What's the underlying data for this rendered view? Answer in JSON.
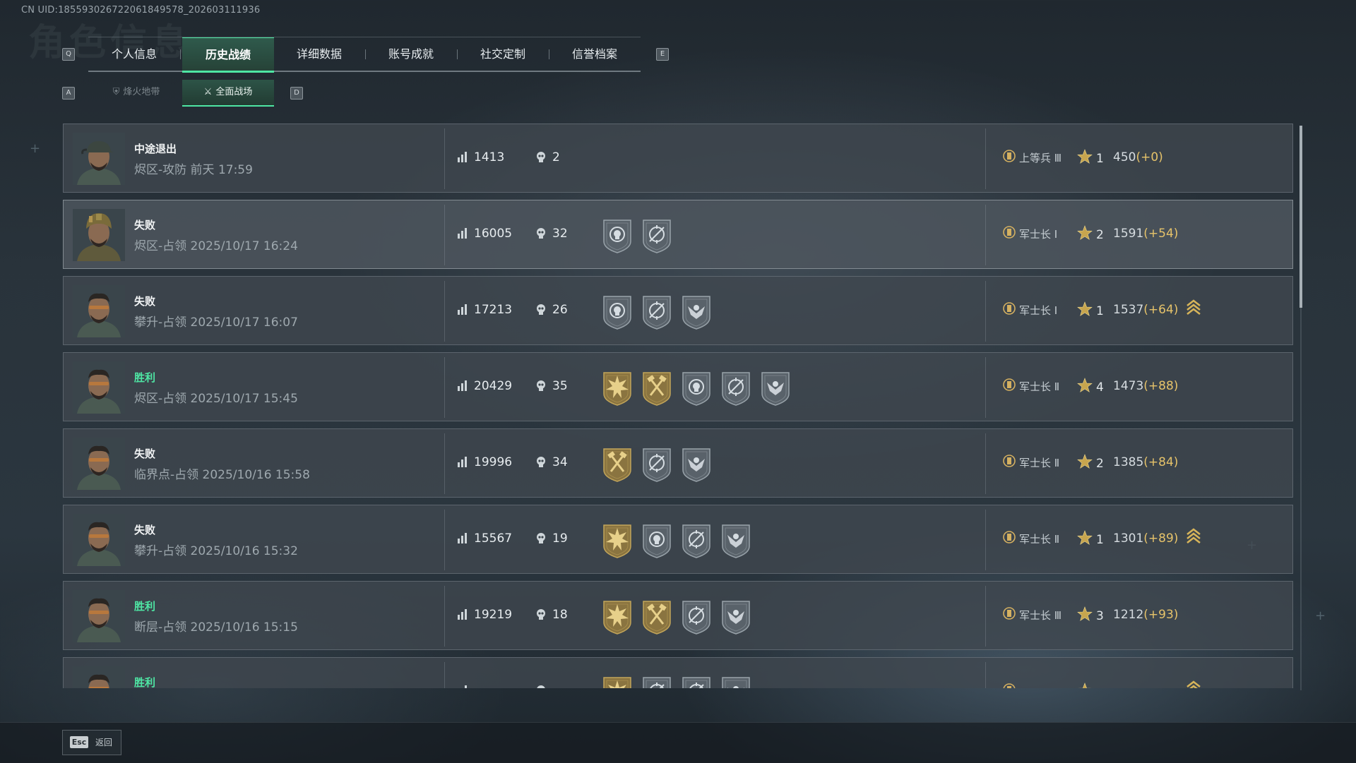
{
  "uid": "CN UID:18559302672206184957​8_202603111936",
  "background_title": "角色信息",
  "tabs": {
    "left_key": "Q",
    "right_key": "E",
    "items": [
      "个人信息",
      "历史战绩",
      "详细数据",
      "账号成就",
      "社交定制",
      "信誉档案"
    ],
    "active_index": 1
  },
  "subtabs": {
    "left_key": "A",
    "right_key": "D",
    "items": [
      {
        "label": "烽火地带",
        "icon": "extraction-icon"
      },
      {
        "label": "全面战场",
        "icon": "battlefield-icon"
      }
    ],
    "active_index": 1
  },
  "colors": {
    "accent": "#4ee6a4",
    "win": "#4ee6a4",
    "delta": "#e6c36a",
    "badge_gold": "#8a7440",
    "badge_silver": "#5d666c"
  },
  "matches": [
    {
      "result": "中途退出",
      "win": false,
      "map_mode": "烬区-攻防 前天 17:59",
      "score": "1413",
      "kills": "2",
      "badges": [],
      "rank_icon": "rank-3",
      "rank": "上等兵 Ⅲ",
      "stars": "1",
      "mmr": "450",
      "delta": "(+0)",
      "promo": false,
      "highlight": false,
      "avatar": "cap"
    },
    {
      "result": "失败",
      "win": false,
      "map_mode": "烬区-占领 2025/10/17 16:24",
      "score": "16005",
      "kills": "32",
      "badges": [
        "skull-silver",
        "crosshair-silver"
      ],
      "rank_icon": "rank-1",
      "rank": "军士长 Ⅰ",
      "stars": "2",
      "mmr": "1591",
      "delta": "(+54)",
      "promo": false,
      "highlight": true,
      "avatar": "helmet"
    },
    {
      "result": "失败",
      "win": false,
      "map_mode": "攀升-占领 2025/10/17 16:07",
      "score": "17213",
      "kills": "26",
      "badges": [
        "skull-silver",
        "crosshair-silver",
        "eagle-silver"
      ],
      "rank_icon": "rank-1",
      "rank": "军士长 Ⅰ",
      "stars": "1",
      "mmr": "1537",
      "delta": "(+64)",
      "promo": true,
      "highlight": false,
      "avatar": "glasses"
    },
    {
      "result": "胜利",
      "win": true,
      "map_mode": "烬区-占领 2025/10/17 15:45",
      "score": "20429",
      "kills": "35",
      "badges": [
        "burst-gold",
        "hammer-gold",
        "skull-silver",
        "crosshair-silver",
        "eagle-silver"
      ],
      "rank_icon": "rank-2",
      "rank": "军士长 Ⅱ",
      "stars": "4",
      "mmr": "1473",
      "delta": "(+88)",
      "promo": false,
      "highlight": false,
      "avatar": "glasses"
    },
    {
      "result": "失败",
      "win": false,
      "map_mode": "临界点-占领 2025/10/16 15:58",
      "score": "19996",
      "kills": "34",
      "badges": [
        "hammer-gold",
        "crosshair-silver",
        "eagle-silver"
      ],
      "rank_icon": "rank-2",
      "rank": "军士长 Ⅱ",
      "stars": "2",
      "mmr": "1385",
      "delta": "(+84)",
      "promo": false,
      "highlight": false,
      "avatar": "glasses"
    },
    {
      "result": "失败",
      "win": false,
      "map_mode": "攀升-占领 2025/10/16 15:32",
      "score": "15567",
      "kills": "19",
      "badges": [
        "burst-gold",
        "skull-silver",
        "crosshair-silver",
        "eagle-silver"
      ],
      "rank_icon": "rank-2",
      "rank": "军士长 Ⅱ",
      "stars": "1",
      "mmr": "1301",
      "delta": "(+89)",
      "promo": true,
      "highlight": false,
      "avatar": "glasses"
    },
    {
      "result": "胜利",
      "win": true,
      "map_mode": "断层-占领 2025/10/16 15:15",
      "score": "19219",
      "kills": "18",
      "badges": [
        "burst-gold",
        "hammer-gold",
        "crosshair-silver",
        "eagle-silver"
      ],
      "rank_icon": "rank-3",
      "rank": "军士长 Ⅲ",
      "stars": "3",
      "mmr": "1212",
      "delta": "(+93)",
      "promo": false,
      "highlight": false,
      "avatar": "glasses"
    },
    {
      "result": "胜利",
      "win": true,
      "map_mode": "",
      "score": "",
      "kills": "",
      "badges": [
        "burst-gold",
        "crosshair-silver",
        "crosshair-silver",
        "eagle-silver"
      ],
      "rank_icon": "rank-3",
      "rank": "",
      "stars": "",
      "mmr": "",
      "delta": "",
      "promo": true,
      "highlight": false,
      "avatar": "glasses"
    }
  ],
  "footer": {
    "key": "Esc",
    "label": "返回"
  }
}
